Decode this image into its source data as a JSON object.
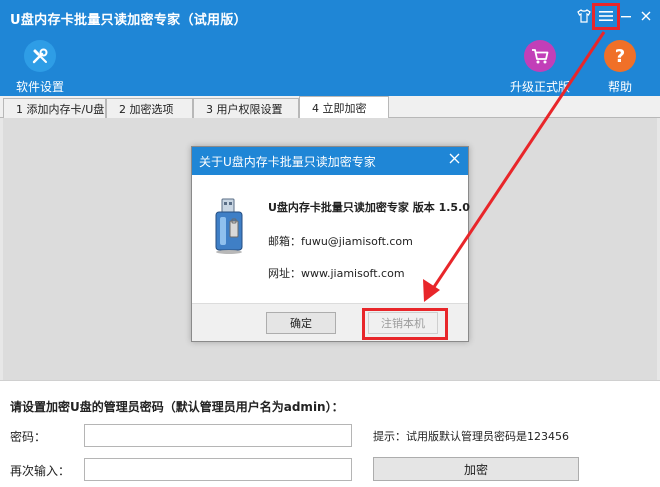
{
  "window": {
    "title": "U盘内存卡批量只读加密专家（试用版）"
  },
  "toolbar": {
    "settings_label": "软件设置",
    "upgrade_label": "升级正式版",
    "help_label": "帮助",
    "help_glyph": "?"
  },
  "tabs": [
    {
      "label": "1 添加内存卡/U盘"
    },
    {
      "label": "2 加密选项"
    },
    {
      "label": "3 用户权限设置"
    },
    {
      "label": "4 立即加密"
    }
  ],
  "dialog": {
    "title": "关于U盘内存卡批量只读加密专家",
    "product_line": "U盘内存卡批量只读加密专家 版本 1.5.0",
    "email_line": "邮箱：fuwu@jiamisoft.com",
    "website_line": "网址：www.jiamisoft.com",
    "ok_label": "确定",
    "unregister_label": "注销本机"
  },
  "password_form": {
    "title": "请设置加密U盘的管理员密码（默认管理员用户名为admin）：",
    "password_label": "密码：",
    "confirm_label": "再次输入：",
    "hint": "提示：试用版默认管理员密码是123456",
    "encrypt_label": "加密"
  },
  "colors": {
    "titlebar": "#1f86d6",
    "highlight": "#e8262a",
    "settings_icon_bg": "#2e9de6",
    "upgrade_icon_bg": "#c23fb8",
    "help_icon_bg": "#f07028"
  },
  "icons": {
    "skin": "shirt-icon",
    "menu": "menu-icon",
    "minimize": "minimize-icon",
    "close": "close-icon",
    "settings": "wrench-screwdriver-icon",
    "upgrade": "shopping-cart-icon",
    "help": "question-icon",
    "usb": "usb-drive-icon"
  }
}
